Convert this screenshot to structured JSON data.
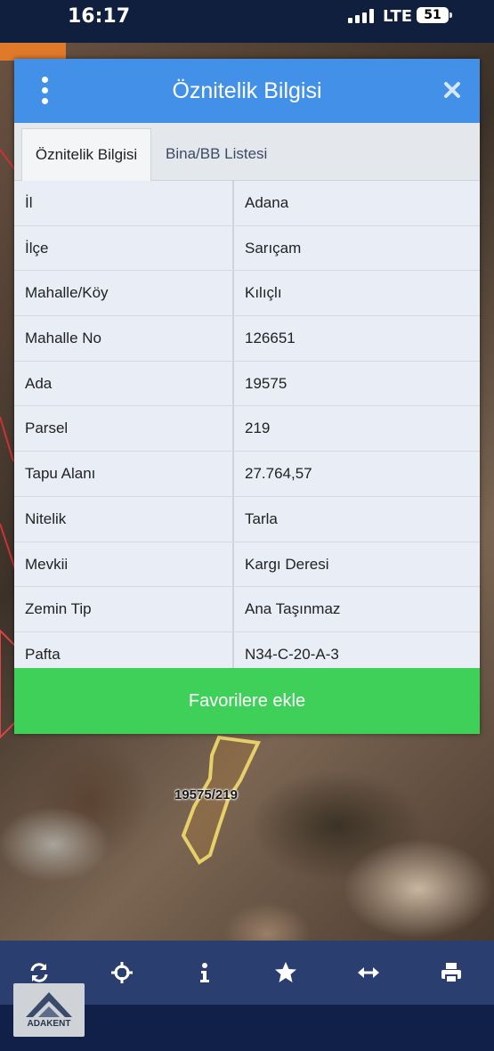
{
  "status_bar": {
    "time": "16:17",
    "network": "LTE",
    "battery": "51"
  },
  "dialog": {
    "title": "Öznitelik Bilgisi",
    "tabs": [
      {
        "label": "Öznitelik Bilgisi",
        "active": true
      },
      {
        "label": "Bina/BB Listesi",
        "active": false
      }
    ],
    "rows": [
      {
        "key": "İl",
        "value": "Adana"
      },
      {
        "key": "İlçe",
        "value": "Sarıçam"
      },
      {
        "key": "Mahalle/Köy",
        "value": "Kılıçlı"
      },
      {
        "key": "Mahalle No",
        "value": "126651"
      },
      {
        "key": "Ada",
        "value": "19575"
      },
      {
        "key": "Parsel",
        "value": "219"
      },
      {
        "key": "Tapu Alanı",
        "value": "27.764,57"
      },
      {
        "key": "Nitelik",
        "value": "Tarla"
      },
      {
        "key": "Mevkii",
        "value": "Kargı Deresi"
      },
      {
        "key": "Zemin Tip",
        "value": "Ana Taşınmaz"
      },
      {
        "key": "Pafta",
        "value": "N34-C-20-A-3"
      }
    ],
    "favorite_button": "Favorilere ekle"
  },
  "map": {
    "parcel_label": "19575/219"
  },
  "toolbar": {
    "icons": [
      "refresh-icon",
      "crosshair-icon",
      "info-icon",
      "star-icon",
      "arrows-horizontal-icon",
      "print-icon"
    ]
  },
  "logo": {
    "text": "ADAKENT"
  },
  "colors": {
    "header": "#4390e8",
    "favorite": "#3fd05a",
    "toolbar": "#2a3f70"
  }
}
